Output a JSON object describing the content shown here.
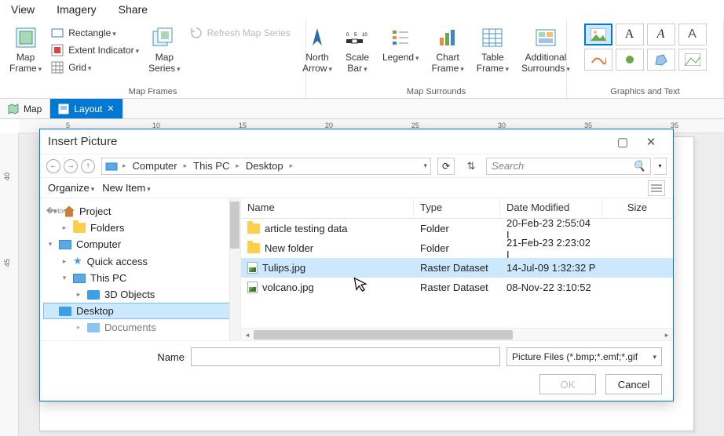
{
  "ribbon": {
    "tabs": [
      "View",
      "Imagery",
      "Share"
    ],
    "map_frame": "Map\nFrame",
    "rectangle": "Rectangle",
    "extent_indicator": "Extent Indicator",
    "grid": "Grid",
    "map_series": "Map\nSeries",
    "refresh_map_series": "Refresh Map Series",
    "group_map_frames": "Map Frames",
    "north_arrow": "North\nArrow",
    "scale_bar": "Scale\nBar",
    "legend": "Legend",
    "chart_frame": "Chart\nFrame",
    "table_frame": "Table\nFrame",
    "additional_surrounds": "Additional\nSurrounds",
    "group_map_surrounds": "Map Surrounds",
    "group_graphics": "Graphics and Text"
  },
  "doc_tabs": {
    "map": "Map",
    "layout": "Layout"
  },
  "ruler_h": [
    "5",
    "10",
    "15",
    "20",
    "25",
    "30",
    "35"
  ],
  "ruler_v": [
    "40",
    "45"
  ],
  "dialog": {
    "title": "Insert Picture",
    "path": {
      "computer": "Computer",
      "this_pc": "This PC",
      "desktop": "Desktop"
    },
    "search_placeholder": "Search",
    "organize": "Organize",
    "new_item": "New Item",
    "tree": {
      "project": "Project",
      "folders": "Folders",
      "computer": "Computer",
      "quick_access": "Quick access",
      "this_pc": "This PC",
      "3d_objects": "3D Objects",
      "desktop": "Desktop",
      "documents": "Documents"
    },
    "columns": {
      "name": "Name",
      "type": "Type",
      "date": "Date Modified",
      "size": "Size"
    },
    "rows": [
      {
        "name": "article testing data",
        "type": "Folder",
        "date": "20-Feb-23 2:55:04 I",
        "kind": "folder"
      },
      {
        "name": "New folder",
        "type": "Folder",
        "date": "21-Feb-23 2:23:02 I",
        "kind": "folder"
      },
      {
        "name": "Tulips.jpg",
        "type": "Raster Dataset",
        "date": "14-Jul-09 1:32:32 P",
        "kind": "image",
        "selected": true
      },
      {
        "name": "volcano.jpg",
        "type": "Raster Dataset",
        "date": "08-Nov-22 3:10:52",
        "kind": "image"
      }
    ],
    "name_label": "Name",
    "filter": "Picture Files (*.bmp;*.emf;*.gif",
    "ok": "OK",
    "cancel": "Cancel"
  }
}
